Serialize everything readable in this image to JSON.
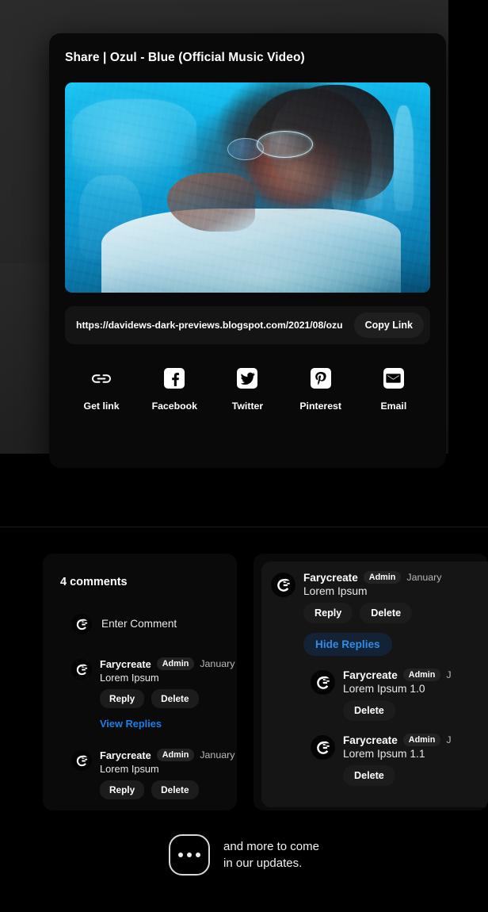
{
  "share_modal": {
    "title": "Share | Ozul - Blue (Official Music Video)",
    "thumbnail_alt": "Ozul - Blue official music video thumbnail",
    "url": "https://davidews-dark-previews.blogspot.com/2021/08/ozu",
    "copy_label": "Copy Link",
    "targets": [
      {
        "icon": "link-icon",
        "label": "Get link"
      },
      {
        "icon": "facebook-icon",
        "label": "Facebook"
      },
      {
        "icon": "twitter-icon",
        "label": "Twitter"
      },
      {
        "icon": "pinterest-icon",
        "label": "Pinterest"
      },
      {
        "icon": "email-icon",
        "label": "Email"
      }
    ]
  },
  "comments_left": {
    "count_label": "4 comments",
    "enter_placeholder": "Enter Comment",
    "items": [
      {
        "author": "Farycreate",
        "badge": "Admin",
        "date": "January",
        "text": "Lorem Ipsum",
        "reply_label": "Reply",
        "delete_label": "Delete",
        "toggle_label": "View Replies"
      },
      {
        "author": "Farycreate",
        "badge": "Admin",
        "date": "January",
        "text": "Lorem Ipsum",
        "reply_label": "Reply",
        "delete_label": "Delete"
      }
    ]
  },
  "comments_right": {
    "root": {
      "author": "Farycreate",
      "badge": "Admin",
      "date": "January",
      "text": "Lorem Ipsum",
      "reply_label": "Reply",
      "delete_label": "Delete",
      "toggle_label": "Hide Replies"
    },
    "replies": [
      {
        "author": "Farycreate",
        "badge": "Admin",
        "date": "J",
        "text": "Lorem Ipsum 1.0",
        "delete_label": "Delete"
      },
      {
        "author": "Farycreate",
        "badge": "Admin",
        "date": "J",
        "text": "Lorem Ipsum 1.1",
        "delete_label": "Delete"
      }
    ]
  },
  "footer": {
    "icon": "ellipsis-icon",
    "line1": "and more to come",
    "line2": "in our updates."
  },
  "colors": {
    "page_bg": "#000000",
    "backdrop": "#262626",
    "modal_bg": "#090909",
    "panel_bg": "#0a0a0a",
    "panel_inner_bg": "#151515",
    "pill_bg": "#1c1c1c",
    "accent_blue": "#1a7fe8",
    "accent_blue_light": "#2e8ce8",
    "thumb_cyan": "#0fb4e8",
    "text_primary": "#ffffff",
    "text_muted": "#b9b9b9"
  }
}
